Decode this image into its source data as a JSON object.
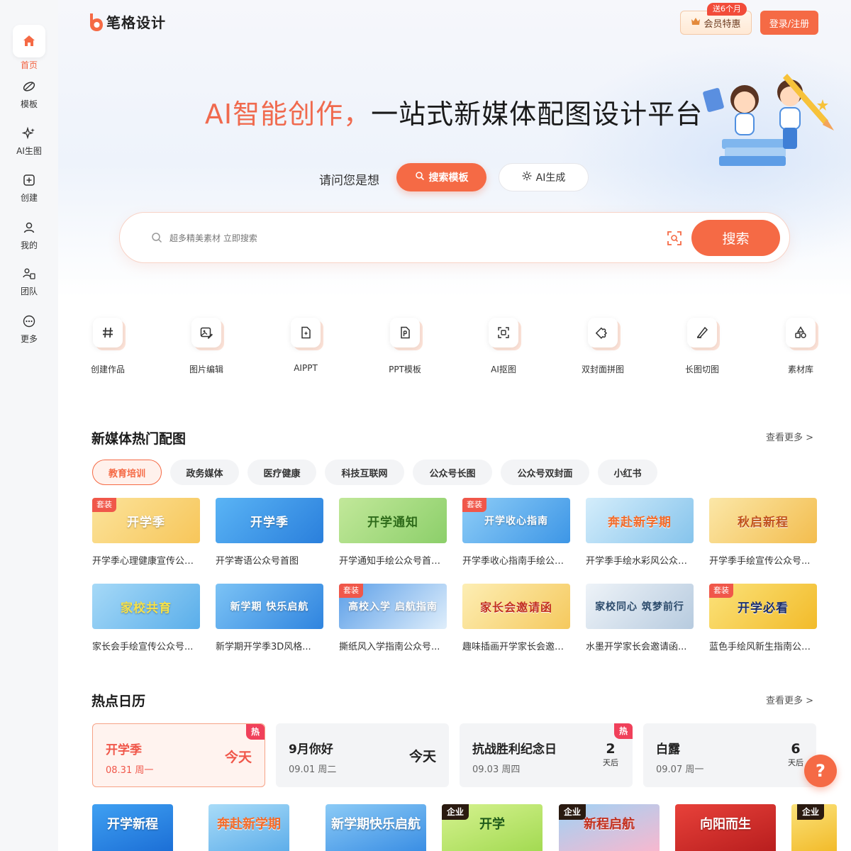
{
  "brand": {
    "name": "笔格设计",
    "accent": "#f56a45"
  },
  "sidebar": {
    "items": [
      {
        "label": "首页",
        "icon": "home-icon"
      },
      {
        "label": "模板",
        "icon": "leaf-icon"
      },
      {
        "label": "AI生图",
        "icon": "sparkle-icon"
      },
      {
        "label": "创建",
        "icon": "plus-square-icon"
      },
      {
        "label": "我的",
        "icon": "user-icon"
      },
      {
        "label": "团队",
        "icon": "team-icon"
      },
      {
        "label": "更多",
        "icon": "more-icon"
      }
    ]
  },
  "header": {
    "vip_label": "会员特惠",
    "vip_tag": "送6个月",
    "login_label": "登录/注册"
  },
  "hero": {
    "title_accent": "AI智能创作，",
    "title_rest": "一站式新媒体配图设计平台",
    "ask_label": "请问您是想",
    "mode_search": "搜索模板",
    "mode_ai": "AI生成",
    "search_placeholder": "超多精美素材 立即搜索",
    "search_button": "搜索"
  },
  "tools": [
    {
      "label": "创建作品",
      "icon": "hash-icon"
    },
    {
      "label": "图片编辑",
      "icon": "image-edit-icon"
    },
    {
      "label": "AIPPT",
      "icon": "ai-doc-icon"
    },
    {
      "label": "PPT模板",
      "icon": "ppt-icon"
    },
    {
      "label": "AI抠图",
      "icon": "cutout-icon"
    },
    {
      "label": "双封面拼图",
      "icon": "puzzle-icon"
    },
    {
      "label": "长图切图",
      "icon": "knife-icon"
    },
    {
      "label": "素材库",
      "icon": "shapes-icon"
    }
  ],
  "hot_section": {
    "title": "新媒体热门配图",
    "more": "查看更多 >",
    "chips": [
      "教育培训",
      "政务媒体",
      "医疗健康",
      "科技互联网",
      "公众号长图",
      "公众号双封面",
      "小红书"
    ],
    "active_chip": "教育培训",
    "cards": [
      {
        "title": "开学季心理健康宣传公众号...",
        "thumb_text": "开学季",
        "badge": "套装",
        "color": "#f7d36a"
      },
      {
        "title": "开学寄语公众号首图",
        "thumb_text": "开学季",
        "badge": "",
        "color": "#3b9be8"
      },
      {
        "title": "开学通知手绘公众号首图...",
        "thumb_text": "开学通知",
        "badge": "",
        "color": "#9fd67a"
      },
      {
        "title": "开学季收心指南手绘公众号...",
        "thumb_text": "开学收心指南",
        "badge": "套装",
        "color": "#5fb3f0"
      },
      {
        "title": "开学季手绘水彩风公众号...",
        "thumb_text": "奔赴新学期",
        "badge": "",
        "color": "#9fd1ee"
      },
      {
        "title": "开学季手绘宣传公众号...",
        "thumb_text": "秋启新程",
        "badge": "",
        "color": "#f4c65c"
      },
      {
        "title": "家长会手绘宣传公众号...",
        "thumb_text": "家校共育",
        "badge": "",
        "color": "#7cc2ee"
      },
      {
        "title": "新学期开学季3D风格...",
        "thumb_text": "新学期 快乐启航",
        "badge": "",
        "color": "#5aa6ea"
      },
      {
        "title": "撕纸风入学指南公众号...",
        "thumb_text": "高校入学 启航指南",
        "badge": "套装",
        "color": "#4e8fe0"
      },
      {
        "title": "趣味插画开学家长会邀请...",
        "thumb_text": "家长会邀请函",
        "badge": "",
        "color": "#f8d67b"
      },
      {
        "title": "水墨开学家长会邀请函...",
        "thumb_text": "家校同心 筑梦前行",
        "badge": "",
        "color": "#b9cde0"
      },
      {
        "title": "蓝色手绘风新生指南公众号...",
        "thumb_text": "开学必看",
        "badge": "套装",
        "color": "#f5c840"
      }
    ]
  },
  "calendar_section": {
    "title": "热点日历",
    "more": "查看更多 >",
    "items": [
      {
        "name": "开学季",
        "date": "08.31 周一",
        "status": "今天",
        "hot": "热"
      },
      {
        "name": "9月你好",
        "date": "09.01 周二",
        "status": "今天",
        "hot": ""
      },
      {
        "name": "抗战胜利纪念日",
        "date": "09.03 周四",
        "count": "2",
        "unit": "天后",
        "hot": "热"
      },
      {
        "name": "白露",
        "date": "09.07 周一",
        "count": "6",
        "unit": "天后",
        "hot": ""
      }
    ]
  },
  "bottom_thumbs": [
    {
      "text": "开学新程",
      "tag": "",
      "color": "#2d8be6"
    },
    {
      "text": "奔赴新学期",
      "tag": "",
      "color": "#7bc0f0"
    },
    {
      "text": "新学期快乐启航",
      "tag": "",
      "color": "#5aa2ea"
    },
    {
      "text": "开学",
      "tag": "企业",
      "color": "#b5e36a"
    },
    {
      "text": "新程启航",
      "tag": "企业",
      "color": "#f3a9c4"
    },
    {
      "text": "向阳而生",
      "tag": "",
      "color": "#e0302f"
    },
    {
      "text": "",
      "tag": "企业",
      "color": "#f5cd56"
    }
  ],
  "help": {
    "label": "?"
  }
}
